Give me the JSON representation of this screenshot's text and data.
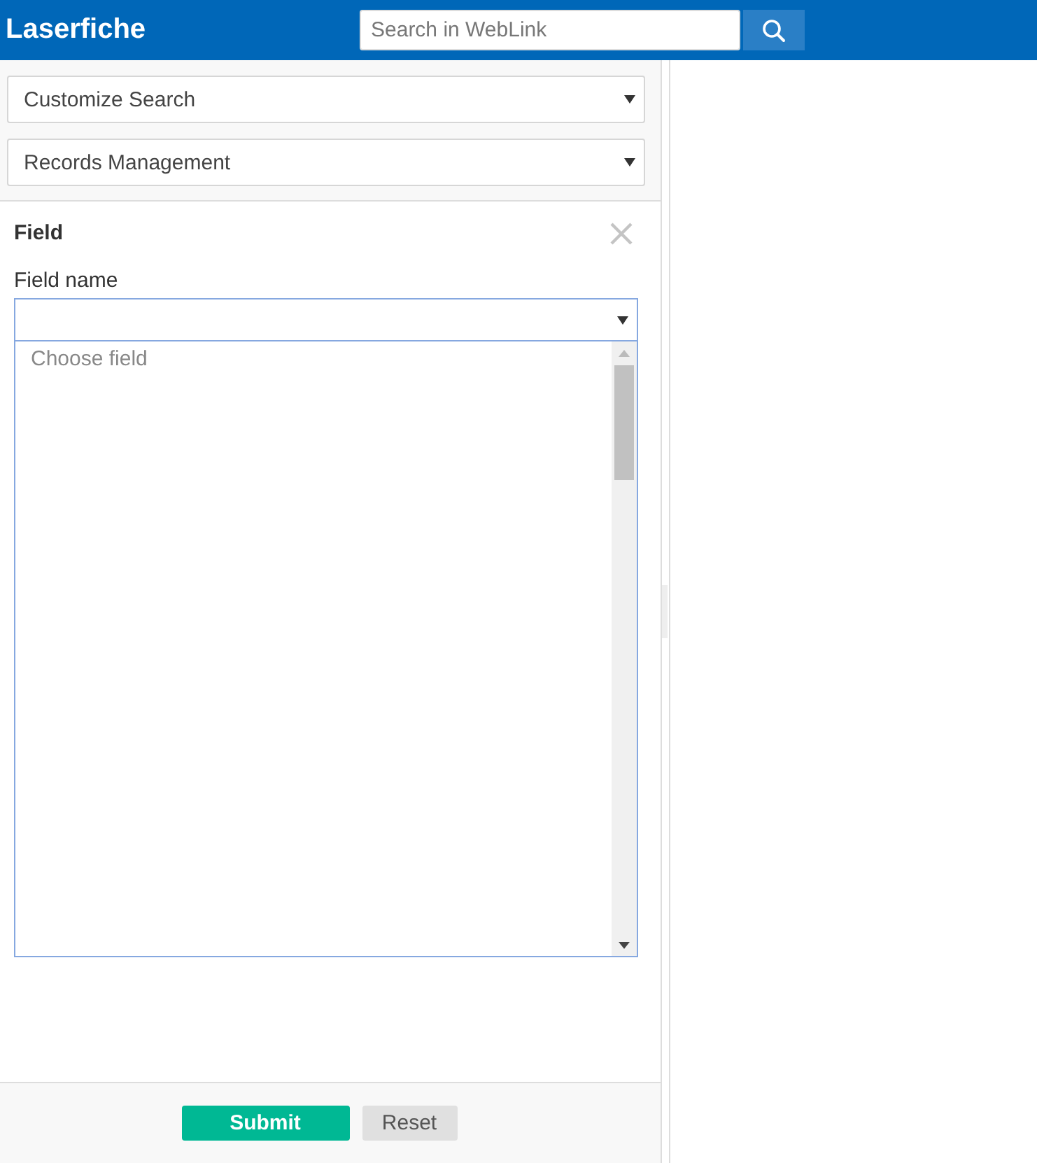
{
  "header": {
    "logo": "Laserfiche",
    "search": {
      "placeholder": "Search in WebLink"
    }
  },
  "dropdowns": [
    {
      "value": "Customize Search"
    },
    {
      "value": "Records Management"
    }
  ],
  "field_panel": {
    "title": "Field",
    "label": "Field name",
    "select": {
      "expanded": true
    },
    "options": [
      {
        "label": "Choose field",
        "selected": false
      }
    ]
  },
  "buttons": [
    {
      "label": "Submit",
      "kind": "primary"
    },
    {
      "label": "Reset",
      "kind": "secondary"
    }
  ]
}
